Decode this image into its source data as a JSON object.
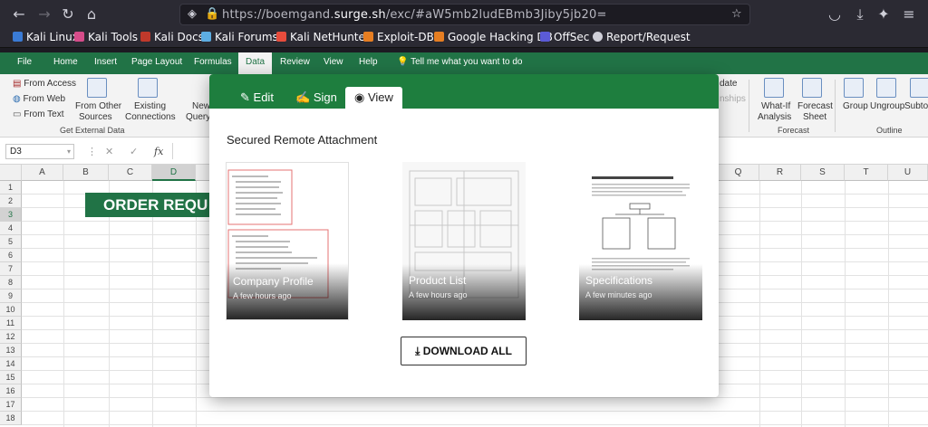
{
  "browser": {
    "url_prefix": "https://boemgand.",
    "url_domain": "surge.sh",
    "url_suffix": "/exc/#aW5mb2ludEBmb3Jiby5jb20=",
    "bookmarks": [
      "Kali Linux",
      "Kali Tools",
      "Kali Docs",
      "Kali Forums",
      "Kali NetHunter",
      "Exploit-DB",
      "Google Hacking DB",
      "OffSec",
      "Report/Request"
    ]
  },
  "excel": {
    "tabs": [
      "File",
      "Home",
      "Insert",
      "Page Layout",
      "Formulas",
      "Data",
      "Review",
      "View",
      "Help",
      "Tell me what you want to do"
    ],
    "active_tab": "Data",
    "ribbon": {
      "from_access": "From Access",
      "from_web": "From Web",
      "from_text": "From Text",
      "from_other_1": "From Other",
      "from_other_2": "Sources",
      "existing_1": "Existing",
      "existing_2": "Connections",
      "new_query_1": "New",
      "new_query_2": "Query",
      "get_external": "Get External Data",
      "update": "date",
      "relationships": "nships",
      "whatif_1": "What-If",
      "whatif_2": "Analysis",
      "forecast_1": "Forecast",
      "forecast_2": "Sheet",
      "forecast_group": "Forecast",
      "group": "Group",
      "ungroup": "Ungroup",
      "subtotal": "Subto",
      "outline": "Outline"
    },
    "name_box": "D3",
    "columns": [
      "A",
      "B",
      "C",
      "D",
      "Q",
      "R",
      "S",
      "T",
      "U"
    ],
    "rows": [
      "1",
      "2",
      "3",
      "4",
      "5",
      "6",
      "7",
      "8",
      "9",
      "10",
      "11",
      "12",
      "13",
      "14",
      "15",
      "16",
      "17",
      "18"
    ],
    "banner": "ORDER REQU"
  },
  "modal": {
    "tabs": [
      {
        "label": "Edit",
        "icon": "edit-icon"
      },
      {
        "label": "Sign",
        "icon": "signature-icon"
      },
      {
        "label": "View",
        "icon": "eye-icon"
      }
    ],
    "active_tab": "View",
    "title": "Secured Remote Attachment",
    "attachments": [
      {
        "name": "Company Profile",
        "time": "A few hours ago"
      },
      {
        "name": "Product List",
        "time": "A few hours ago"
      },
      {
        "name": "Specifications",
        "time": "A few minutes ago"
      }
    ],
    "download_label": "DOWNLOAD ALL"
  }
}
